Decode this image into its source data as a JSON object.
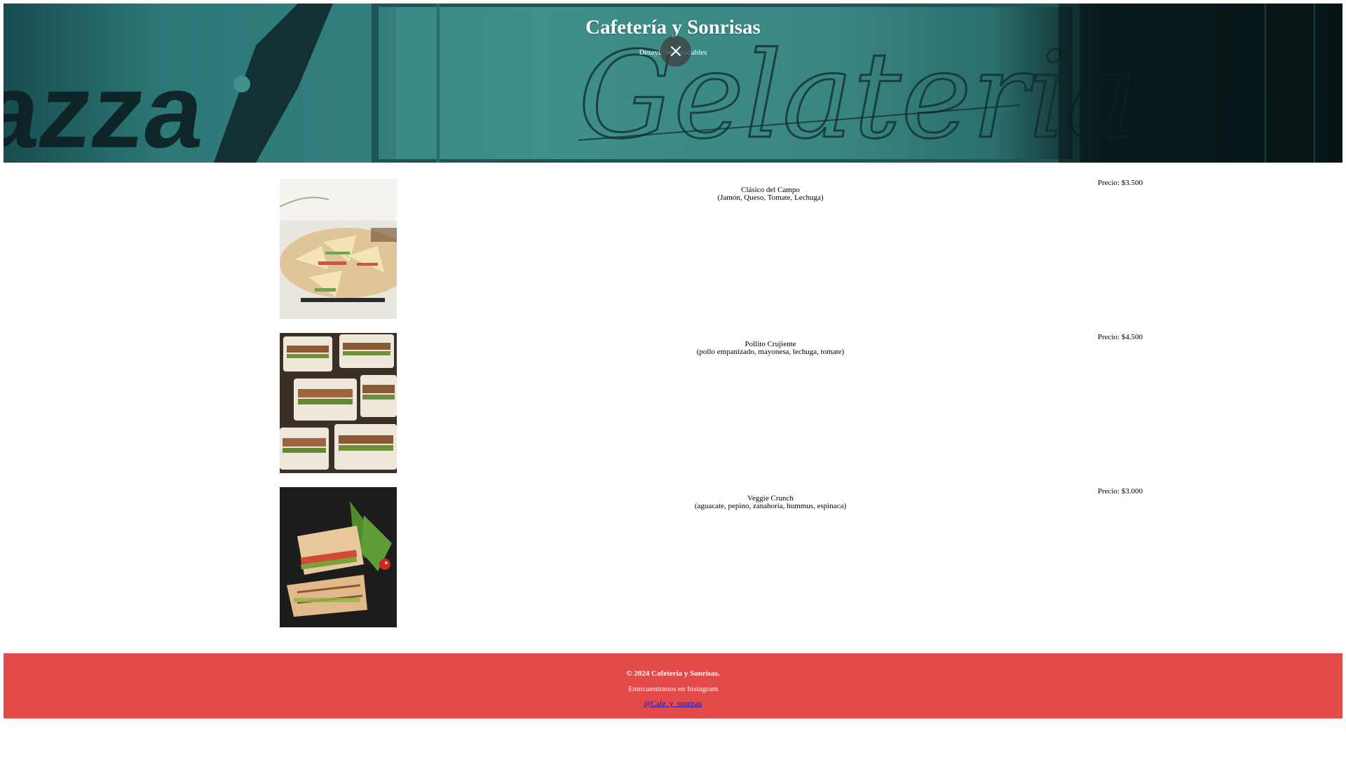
{
  "header": {
    "title": "Cafetería y Sonrisas",
    "subtitle": "Desayunos saludables",
    "close_icon": "close-icon"
  },
  "menu": [
    {
      "name": "Clásico del Campo",
      "ingredients": "(Jamón, Queso, Tomate, Lechuga)",
      "price": "Precio: $3.500"
    },
    {
      "name": "Pollito Crujiente",
      "ingredients": "(pollo empanizado, mayonesa, lechuga, tomate)",
      "price": "Precio: $4.500"
    },
    {
      "name": "Veggie Crunch",
      "ingredients": "(aguacate, pepino, zanahoria, hummus, espinaca)",
      "price": "Precio: $3.000"
    }
  ],
  "footer": {
    "copyright": "© 2024 Cafetería y Sonrisas.",
    "instagram_text": "Emncuentranos en Instagram",
    "instagram_handle": "@Cafe_y_sonrisas"
  },
  "colors": {
    "footer_bg": "#e34b4a",
    "hero_teal": "#3f8f8b"
  }
}
